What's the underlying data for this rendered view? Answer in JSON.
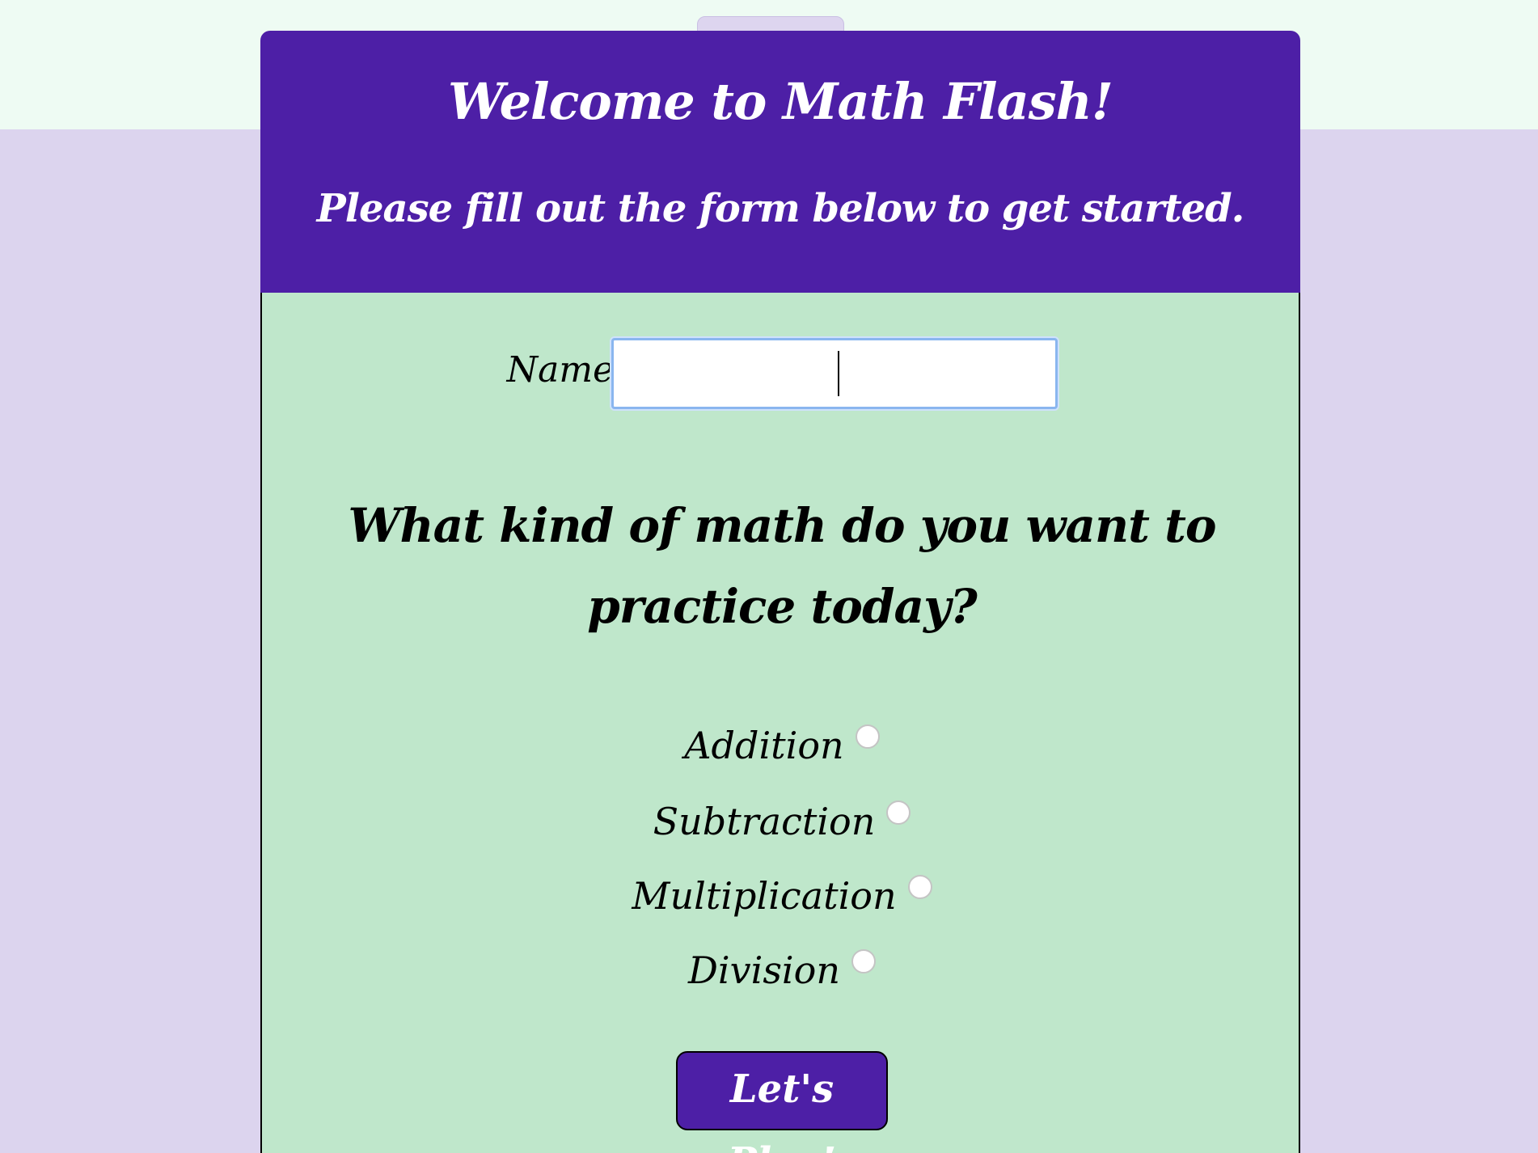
{
  "header": {
    "title": "Welcome to Math Flash!",
    "subtitle": "Please fill out the form below to get started."
  },
  "form": {
    "name_label": "Name:",
    "name_value": "",
    "name_placeholder": "",
    "question": "What kind of math do you want to practice today?",
    "options": [
      {
        "label": "Addition",
        "selected": false
      },
      {
        "label": "Subtraction",
        "selected": false
      },
      {
        "label": "Multiplication",
        "selected": false
      },
      {
        "label": "Division",
        "selected": false
      }
    ],
    "submit_label": "Let's Play!"
  },
  "colors": {
    "header_bg": "#4d1fa6",
    "body_bg": "#bfe7cb",
    "page_bg": "#dcd4ee",
    "top_band": "#eefbf3",
    "button_bg": "#4d1fa6"
  }
}
